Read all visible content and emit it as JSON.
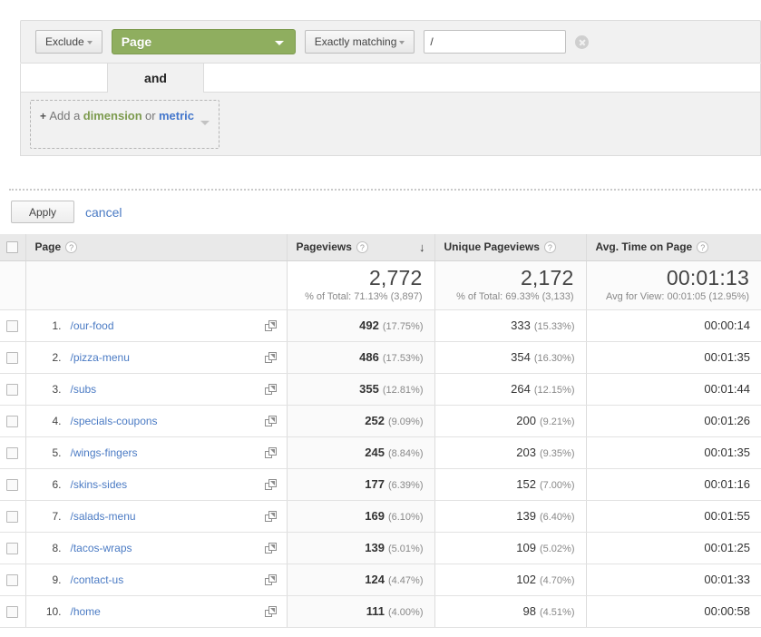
{
  "filter_builder": {
    "exclude_button": "Exclude",
    "dimension_select": "Page",
    "match_type": "Exactly matching",
    "value": "/",
    "value_placeholder": "",
    "and_label": "and",
    "add_prefix": "+",
    "add_text_1": "Add a",
    "add_dimension": "dimension",
    "add_or": "or",
    "add_metric": "metric",
    "apply_label": "Apply",
    "cancel_label": "cancel",
    "dimension_color": "#8fae5f",
    "metric_color": "#4477cc"
  },
  "table": {
    "headers": {
      "page": "Page",
      "pageviews": "Pageviews",
      "unique_pageviews": "Unique Pageviews",
      "avg_time_on_page": "Avg. Time on Page",
      "help_glyph": "?",
      "sort_glyph": "↓"
    },
    "summary": {
      "pageviews_value": "2,772",
      "pageviews_sub": "% of Total: 71.13% (3,897)",
      "unique_value": "2,172",
      "unique_sub": "% of Total: 69.33% (3,133)",
      "time_value": "00:01:13",
      "time_sub": "Avg for View: 00:01:05 (12.95%)"
    },
    "rows": [
      {
        "num": "1.",
        "page": "/our-food",
        "pageviews": "492",
        "pv_pct": "(17.75%)",
        "unique": "333",
        "u_pct": "(15.33%)",
        "time": "00:00:14"
      },
      {
        "num": "2.",
        "page": "/pizza-menu",
        "pageviews": "486",
        "pv_pct": "(17.53%)",
        "unique": "354",
        "u_pct": "(16.30%)",
        "time": "00:01:35"
      },
      {
        "num": "3.",
        "page": "/subs",
        "pageviews": "355",
        "pv_pct": "(12.81%)",
        "unique": "264",
        "u_pct": "(12.15%)",
        "time": "00:01:44"
      },
      {
        "num": "4.",
        "page": "/specials-coupons",
        "pageviews": "252",
        "pv_pct": "(9.09%)",
        "unique": "200",
        "u_pct": "(9.21%)",
        "time": "00:01:26"
      },
      {
        "num": "5.",
        "page": "/wings-fingers",
        "pageviews": "245",
        "pv_pct": "(8.84%)",
        "unique": "203",
        "u_pct": "(9.35%)",
        "time": "00:01:35"
      },
      {
        "num": "6.",
        "page": "/skins-sides",
        "pageviews": "177",
        "pv_pct": "(6.39%)",
        "unique": "152",
        "u_pct": "(7.00%)",
        "time": "00:01:16"
      },
      {
        "num": "7.",
        "page": "/salads-menu",
        "pageviews": "169",
        "pv_pct": "(6.10%)",
        "unique": "139",
        "u_pct": "(6.40%)",
        "time": "00:01:55"
      },
      {
        "num": "8.",
        "page": "/tacos-wraps",
        "pageviews": "139",
        "pv_pct": "(5.01%)",
        "unique": "109",
        "u_pct": "(5.02%)",
        "time": "00:01:25"
      },
      {
        "num": "9.",
        "page": "/contact-us",
        "pageviews": "124",
        "pv_pct": "(4.47%)",
        "unique": "102",
        "u_pct": "(4.70%)",
        "time": "00:01:33"
      },
      {
        "num": "10.",
        "page": "/home",
        "pageviews": "111",
        "pv_pct": "(4.00%)",
        "unique": "98",
        "u_pct": "(4.51%)",
        "time": "00:00:58"
      }
    ]
  }
}
